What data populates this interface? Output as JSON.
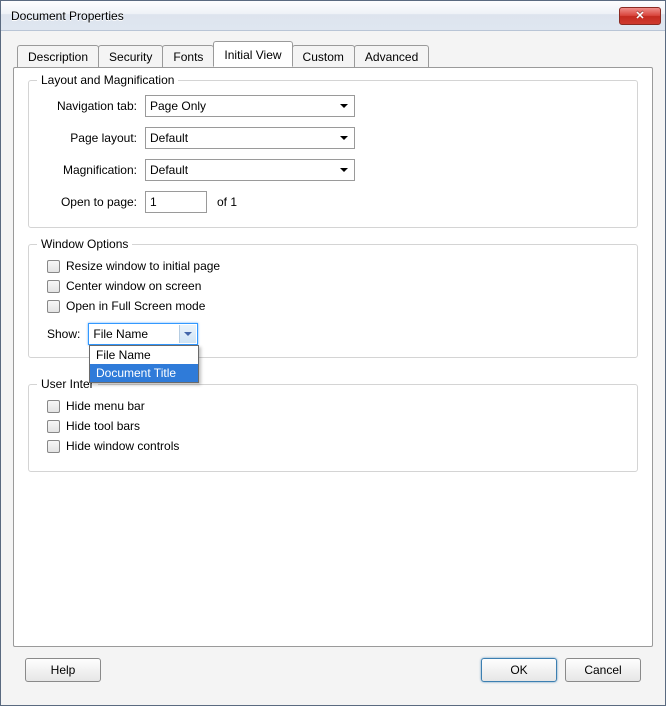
{
  "window": {
    "title": "Document Properties"
  },
  "tabs": [
    {
      "label": "Description"
    },
    {
      "label": "Security"
    },
    {
      "label": "Fonts"
    },
    {
      "label": "Initial View"
    },
    {
      "label": "Custom"
    },
    {
      "label": "Advanced"
    }
  ],
  "active_tab_index": 3,
  "layout_group": {
    "legend": "Layout and Magnification",
    "navigation_tab_label": "Navigation tab:",
    "navigation_tab_value": "Page Only",
    "page_layout_label": "Page layout:",
    "page_layout_value": "Default",
    "magnification_label": "Magnification:",
    "magnification_value": "Default",
    "open_to_page_label": "Open to page:",
    "open_to_page_value": "1",
    "of_text": "of 1"
  },
  "window_options_group": {
    "legend": "Window Options",
    "resize_label": "Resize window to initial page",
    "center_label": "Center window on screen",
    "fullscreen_label": "Open in Full Screen mode",
    "show_label": "Show:",
    "show_value": "File Name",
    "show_options": [
      "File Name",
      "Document Title"
    ],
    "show_selected_index": 1
  },
  "ui_options_group": {
    "legend": "User Interface Options",
    "legend_visible": "User Inter",
    "hide_menu_label": "Hide menu bar",
    "hide_toolbars_label": "Hide tool bars",
    "hide_controls_label": "Hide window controls"
  },
  "buttons": {
    "help": "Help",
    "ok": "OK",
    "cancel": "Cancel"
  }
}
